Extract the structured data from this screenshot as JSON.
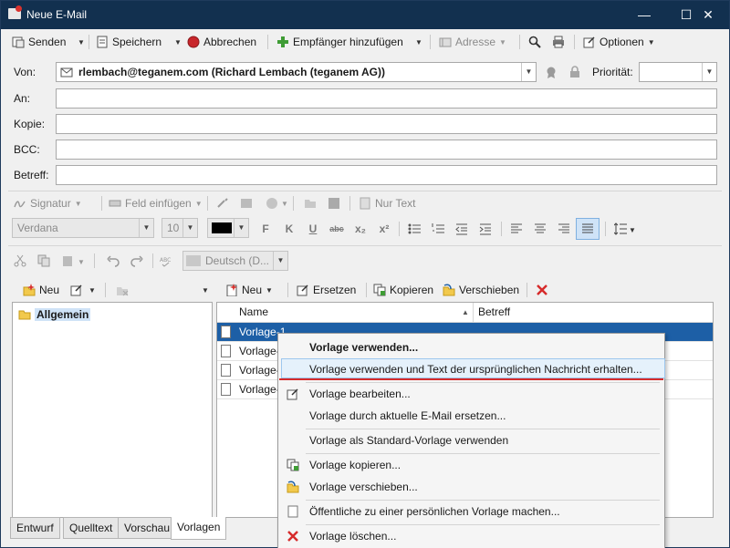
{
  "window": {
    "title": "Neue E-Mail",
    "min": "—",
    "max": "☐",
    "close": "✕"
  },
  "toolbar1": {
    "send": "Senden",
    "save": "Speichern",
    "cancel": "Abbrechen",
    "add_recipient": "Empfänger hinzufügen",
    "address": "Adresse",
    "options": "Optionen"
  },
  "header": {
    "from_label": "Von:",
    "from_value": "rlembach@teganem.com (Richard Lembach (teganem AG))",
    "priority_label": "Priorität:",
    "to_label": "An:",
    "cc_label": "Kopie:",
    "bcc_label": "BCC:",
    "subject_label": "Betreff:"
  },
  "toolbar2": {
    "signature": "Signatur",
    "insert_field": "Feld einfügen",
    "plain_text": "Nur Text"
  },
  "format": {
    "font": "Verdana",
    "size": "10",
    "bold": "F",
    "italic": "K",
    "underline": "U",
    "strike": "abc",
    "subscript": "x₂",
    "superscript": "x²"
  },
  "toolbar3": {
    "language": "Deutsch (D..."
  },
  "templates": {
    "left_new": "Neu",
    "right_new": "Neu",
    "replace": "Ersetzen",
    "copy": "Kopieren",
    "move": "Verschieben",
    "folder": "Allgemein",
    "col_name": "Name",
    "col_subject": "Betreff",
    "rows": [
      "Vorlage-1",
      "Vorlage-",
      "Vorlage-",
      "Vorlage-"
    ]
  },
  "tabs": [
    "Entwurf",
    "Quelltext",
    "Vorschau",
    "Vorlagen"
  ],
  "context_menu": {
    "use": "Vorlage verwenden...",
    "use_with_text": "Vorlage verwenden und Text der ursprünglichen Nachricht erhalten...",
    "edit": "Vorlage bearbeiten...",
    "replace_current": "Vorlage durch aktuelle E-Mail ersetzen...",
    "set_default": "Vorlage als Standard-Vorlage verwenden",
    "copy": "Vorlage kopieren...",
    "move": "Vorlage verschieben...",
    "make_personal": "Öffentliche zu einer persönlichen Vorlage machen...",
    "delete": "Vorlage löschen..."
  }
}
